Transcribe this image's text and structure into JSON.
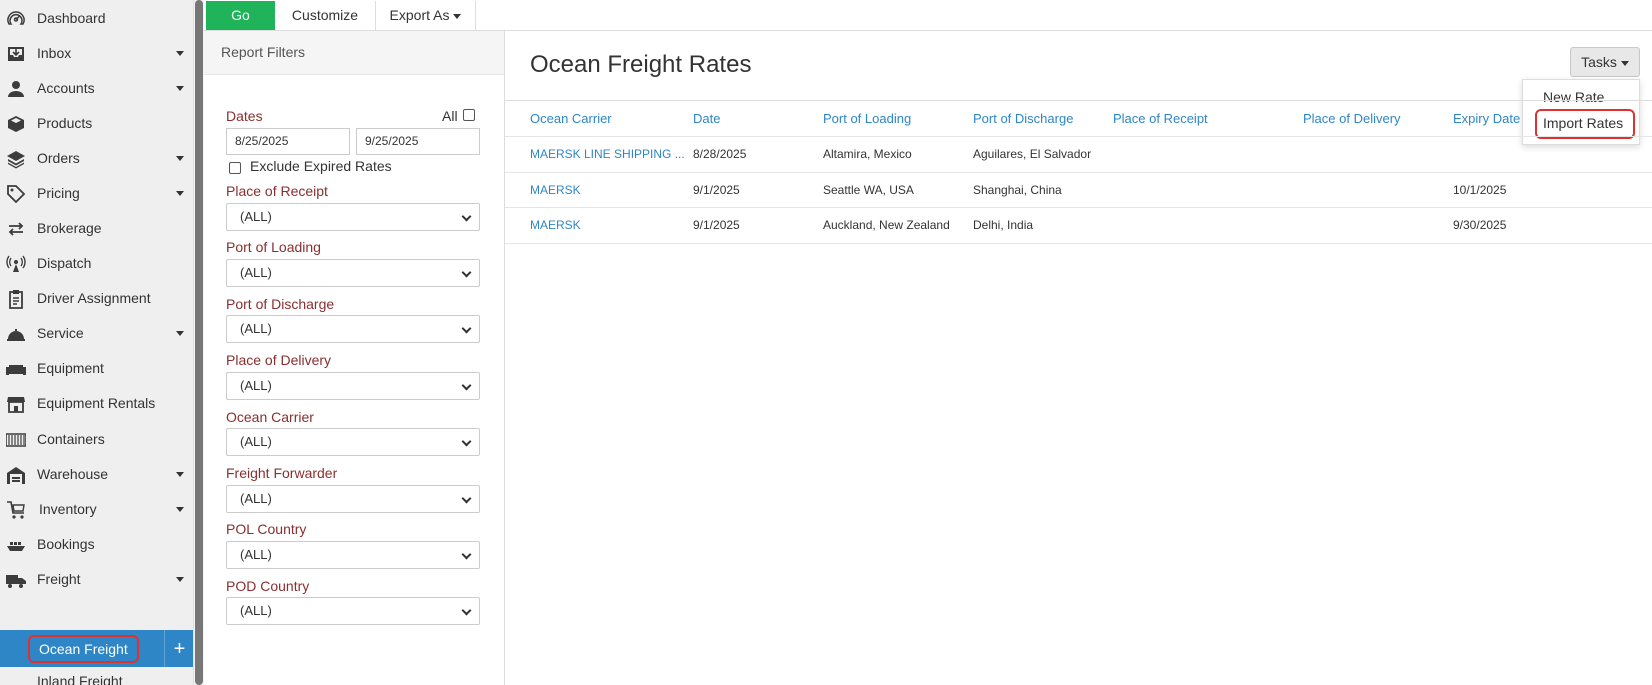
{
  "sidebar": {
    "items": [
      {
        "label": "Dashboard",
        "icon": "dashboard-icon",
        "has_caret": false
      },
      {
        "label": "Inbox",
        "icon": "inbox-icon",
        "has_caret": true
      },
      {
        "label": "Accounts",
        "icon": "user-icon",
        "has_caret": true
      },
      {
        "label": "Products",
        "icon": "box-icon",
        "has_caret": false
      },
      {
        "label": "Orders",
        "icon": "layers-icon",
        "has_caret": true
      },
      {
        "label": "Pricing",
        "icon": "tag-icon",
        "has_caret": true
      },
      {
        "label": "Brokerage",
        "icon": "exchange-icon",
        "has_caret": false
      },
      {
        "label": "Dispatch",
        "icon": "broadcast-icon",
        "has_caret": false
      },
      {
        "label": "Driver Assignment",
        "icon": "clipboard-icon",
        "has_caret": false
      },
      {
        "label": "Service",
        "icon": "bell-icon",
        "has_caret": true
      },
      {
        "label": "Equipment",
        "icon": "sofa-icon",
        "has_caret": false
      },
      {
        "label": "Equipment Rentals",
        "icon": "storefront-icon",
        "has_caret": false
      },
      {
        "label": "Containers",
        "icon": "container-icon",
        "has_caret": false
      },
      {
        "label": "Warehouse",
        "icon": "warehouse-icon",
        "has_caret": true
      },
      {
        "label": "Inventory",
        "icon": "cart-icon",
        "has_caret": true
      },
      {
        "label": "Bookings",
        "icon": "ship-icon",
        "has_caret": false
      },
      {
        "label": "Freight",
        "icon": "truck-icon",
        "has_caret": true
      }
    ],
    "active_item": "Ocean Freight",
    "next_item": "Inland Freight",
    "plus_label": "+"
  },
  "toolbar": {
    "go_label": "Go",
    "customize_label": "Customize",
    "export_label": "Export As"
  },
  "filters": {
    "title": "Report Filters",
    "dates_label": "Dates",
    "all_label": "All",
    "date_from": "8/25/2025",
    "date_to": "9/25/2025",
    "exclude_label": "Exclude Expired Rates",
    "fields": [
      {
        "label": "Place of Receipt",
        "value": "(ALL)"
      },
      {
        "label": "Port of Loading",
        "value": "(ALL)"
      },
      {
        "label": "Port of Discharge",
        "value": "(ALL)"
      },
      {
        "label": "Place of Delivery",
        "value": "(ALL)"
      },
      {
        "label": "Ocean Carrier",
        "value": "(ALL)"
      },
      {
        "label": "Freight Forwarder",
        "value": "(ALL)"
      },
      {
        "label": "POL Country",
        "value": "(ALL)"
      },
      {
        "label": "POD Country",
        "value": "(ALL)"
      }
    ]
  },
  "main": {
    "title": "Ocean Freight Rates",
    "tasks_label": "Tasks",
    "tasks_menu": [
      "New Rate",
      "Import Rates"
    ],
    "columns": [
      "Ocean Carrier",
      "Date",
      "Port of Loading",
      "Port of Discharge",
      "Place of Receipt",
      "Place of Delivery",
      "Expiry Date"
    ],
    "rows": [
      [
        "MAERSK LINE SHIPPING ...",
        "8/28/2025",
        "Altamira, Mexico",
        "Aguilares, El Salvador",
        "",
        "",
        ""
      ],
      [
        "MAERSK",
        "9/1/2025",
        "Seattle WA, USA",
        "Shanghai, China",
        "",
        "",
        "10/1/2025"
      ],
      [
        "MAERSK",
        "9/1/2025",
        "Auckland, New Zealand",
        "Delhi, India",
        "",
        "",
        "9/30/2025"
      ]
    ]
  },
  "colors": {
    "accent": "#2f86c6",
    "go_button": "#1fb35a",
    "label_red": "#8a2f2f",
    "highlight": "#e03030"
  }
}
